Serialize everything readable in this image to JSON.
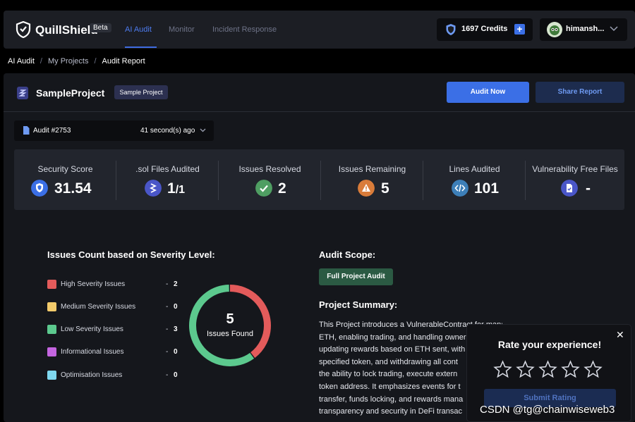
{
  "app": {
    "brand": "QuillShield",
    "beta": "Beta"
  },
  "nav": [
    {
      "label": "AI Audit",
      "active": true
    },
    {
      "label": "Monitor",
      "active": false
    },
    {
      "label": "Incident Response",
      "active": false
    }
  ],
  "credits": {
    "label": "1697 Credits",
    "plus": "+"
  },
  "user": {
    "name": "himansh..."
  },
  "breadcrumb": [
    "AI Audit",
    "My Projects",
    "Audit Report"
  ],
  "project": {
    "title": "SampleProject",
    "tag": "Sample Project",
    "audit_button": "Audit Now",
    "share_button": "Share Report"
  },
  "audit": {
    "number": "Audit #2753",
    "time": "41 second(s) ago"
  },
  "stats": [
    {
      "label": "Security Score",
      "value": "31.54",
      "color": "#3b6fe6",
      "icon": "shield-icon"
    },
    {
      "label": ".sol Files Audited",
      "value": "1",
      "value_suffix": "/1",
      "color": "#4a56c8",
      "icon": "solidity-icon"
    },
    {
      "label": "Issues Resolved",
      "value": "2",
      "color": "#4f9e62",
      "icon": "check-icon"
    },
    {
      "label": "Issues Remaining",
      "value": "5",
      "color": "#d97c3a",
      "icon": "warning-icon"
    },
    {
      "label": "Lines Audited",
      "value": "101",
      "color": "#3d7fb8",
      "icon": "code-icon"
    },
    {
      "label": "Vulnerability Free Files",
      "value": "-",
      "color": "#4a56c8",
      "icon": "file-check-icon"
    }
  ],
  "severity": {
    "title": "Issues Count based on Severity Level:",
    "items": [
      {
        "name": "High Severity Issues",
        "count": "2",
        "color": "#e35b5b"
      },
      {
        "name": "Medium Severity Issues",
        "count": "0",
        "color": "#f3cb6b"
      },
      {
        "name": "Low Severity Issues",
        "count": "3",
        "color": "#5cc98e"
      },
      {
        "name": "Informational Issues",
        "count": "0",
        "color": "#c465e0"
      },
      {
        "name": "Optimisation Issues",
        "count": "0",
        "color": "#7fd8ef"
      }
    ],
    "total": "5",
    "total_label": "Issues Found"
  },
  "scope": {
    "title": "Audit Scope:",
    "value": "Full Project Audit"
  },
  "summary": {
    "title": "Project Summary:",
    "lines": [
      "This Project introduces a VulnerableContract for managing trad",
      "ETH, enabling trading, and handling owner",
      "updating rewards based on ETH sent, with",
      "specified token, and withdrawing all cont",
      "the ability to lock trading, execute extern",
      "token address. It emphasizes events for t",
      "transfer, funds locking, and rewards mana",
      "transparency and security in DeFi transac"
    ]
  },
  "rating": {
    "title": "Rate your experience!",
    "submit": "Submit Rating",
    "close": "✕"
  },
  "watermark": "CSDN @tg@chainwiseweb3"
}
